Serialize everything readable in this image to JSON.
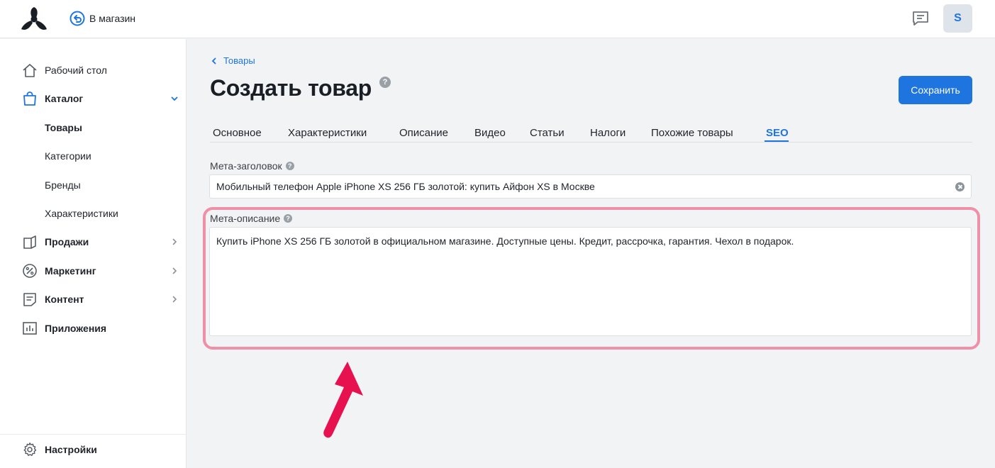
{
  "header": {
    "store_link_label": "В магазин",
    "avatar_initial": "S"
  },
  "sidebar": {
    "items": [
      {
        "label": "Рабочий стол",
        "icon": "home-icon"
      },
      {
        "label": "Каталог",
        "icon": "shopping-bag-icon"
      },
      {
        "label": "Товары"
      },
      {
        "label": "Категории"
      },
      {
        "label": "Бренды"
      },
      {
        "label": "Характеристики"
      },
      {
        "label": "Продажи",
        "icon": "orders-icon"
      },
      {
        "label": "Маркетинг",
        "icon": "percent-icon"
      },
      {
        "label": "Контент",
        "icon": "content-icon"
      },
      {
        "label": "Приложения",
        "icon": "apps-chart-icon"
      }
    ],
    "settings_label": "Настройки"
  },
  "main": {
    "breadcrumb": "Товары",
    "title": "Создать товар",
    "save_label": "Сохранить",
    "tabs": [
      "Основное",
      "Характеристики",
      "Описание",
      "Видео",
      "Статьи",
      "Налоги",
      "Похожие товары",
      "SEO"
    ],
    "active_tab": "SEO",
    "meta_title_label": "Мета-заголовок",
    "meta_title_value": "Мобильный телефон Apple iPhone XS 256 ГБ золотой: купить Айфон XS в Москве",
    "meta_desc_label": "Мета-описание",
    "meta_desc_value": "Купить iPhone XS 256 ГБ золотой в официальном магазине. Доступные цены. Кредит, рассрочка, гарантия. Чехол в подарок."
  },
  "colors": {
    "accent": "#1f75e0",
    "highlight": "#ef8fa8",
    "arrow": "#e8114f"
  }
}
